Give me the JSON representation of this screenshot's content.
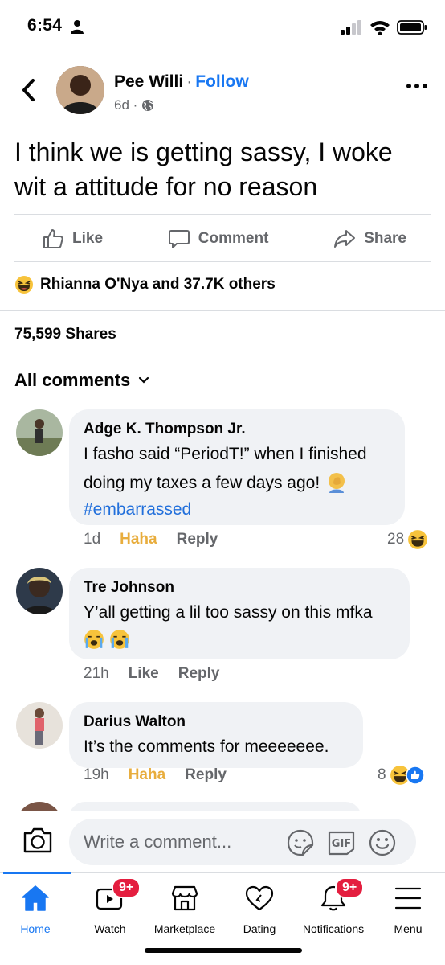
{
  "status_bar": {
    "time": "6:54"
  },
  "post": {
    "author": "Pee Willi",
    "separator": "·",
    "follow_label": "Follow",
    "age": "6d ·",
    "text": "I think we is getting sassy, I woke wit a attitude for no reason",
    "actions": {
      "like": "Like",
      "comment": "Comment",
      "share": "Share"
    },
    "reactions_text": "Rhianna O'Nya and 37.7K others",
    "shares_text": "75,599 Shares"
  },
  "comments_header": "All comments",
  "comments": [
    {
      "name": "Adge K. Thompson Jr.",
      "text_line1": "I fasho said “PeriodT!” when I finished",
      "text_line2": "doing my taxes a few days ago!",
      "hashtag": "#embarrassed",
      "time": "1d",
      "reaction_label": "Haha",
      "reply_label": "Reply",
      "reaction_count": "28"
    },
    {
      "name": "Tre Johnson",
      "text": "Y’all getting a lil too sassy on this mfka",
      "time": "21h",
      "like_label": "Like",
      "reply_label": "Reply"
    },
    {
      "name": "Darius Walton",
      "text": "It’s the comments for meeeeeee.",
      "time": "19h",
      "reaction_label": "Haha",
      "reply_label": "Reply",
      "reaction_count": "8"
    }
  ],
  "composer": {
    "placeholder": "Write a comment...",
    "gif_label": "GIF"
  },
  "tabs": [
    {
      "label": "Home",
      "icon": "home-icon",
      "active": true
    },
    {
      "label": "Watch",
      "icon": "watch-icon",
      "badge": "9+"
    },
    {
      "label": "Marketplace",
      "icon": "marketplace-icon"
    },
    {
      "label": "Dating",
      "icon": "dating-icon"
    },
    {
      "label": "Notifications",
      "icon": "bell-icon",
      "badge": "9+"
    },
    {
      "label": "Menu",
      "icon": "menu-icon"
    }
  ],
  "colors": {
    "accent": "#1877f2",
    "haha": "#e8ad3d",
    "badge": "#e41e3f",
    "bubble": "#f0f2f5"
  }
}
